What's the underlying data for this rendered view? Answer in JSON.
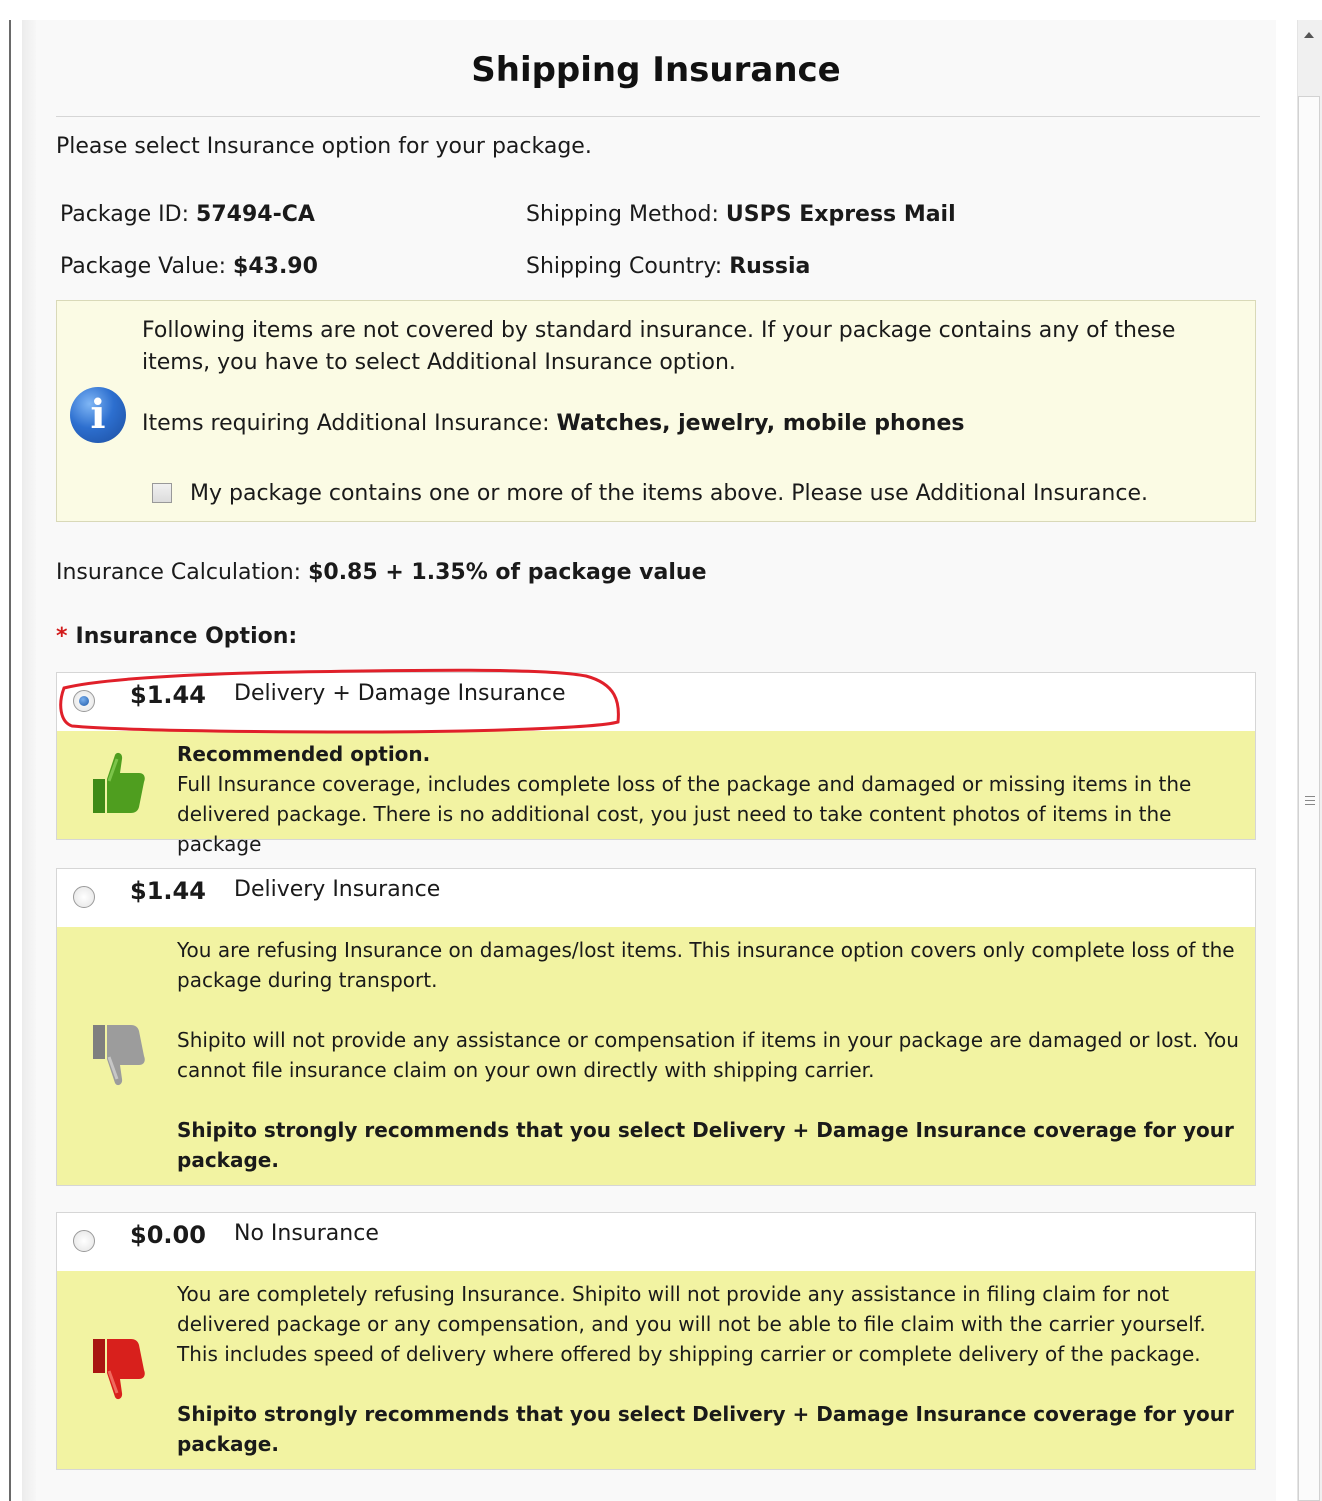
{
  "dialog": {
    "title": "Shipping Insurance",
    "intro": "Please select Insurance option for your package."
  },
  "package": {
    "id_label": "Package ID:",
    "id_value": "57494-CA",
    "value_label": "Package Value:",
    "value_value": "$43.90",
    "method_label": "Shipping Method:",
    "method_value": "USPS Express Mail",
    "country_label": "Shipping Country:",
    "country_value": "Russia"
  },
  "notice": {
    "text": "Following items are not covered by standard insurance. If your package contains any of these items, you have to select Additional Insurance option.",
    "items_label": "Items requiring Additional Insurance:",
    "items_value": "Watches, jewelry, mobile phones",
    "checkbox_label": "My package contains one or more of the items above. Please use Additional Insurance.",
    "checkbox_checked": false
  },
  "calculation": {
    "label": "Insurance Calculation:",
    "value": "$0.85 + 1.35% of package value"
  },
  "options_heading": "Insurance Option:",
  "options": [
    {
      "price": "$1.44",
      "name": "Delivery + Damage Insurance",
      "selected": true,
      "thumb": "thumbs-up",
      "desc_bold": "Recommended option.",
      "desc": "Full Insurance coverage, includes complete loss of the package and damaged or missing items in the delivered package. There is no additional cost, you just need to take content photos of items in the package"
    },
    {
      "price": "$1.44",
      "name": "Delivery Insurance",
      "selected": false,
      "thumb": "thumbs-down-gray",
      "desc1": "You are refusing Insurance on damages/lost items. This insurance option covers only complete loss of the package during transport.",
      "desc2": "Shipito will not provide any assistance or compensation if items in your package are damaged or lost. You cannot file insurance claim on your own directly with shipping carrier.",
      "desc_bold": "Shipito strongly recommends that you select Delivery + Damage Insurance coverage for your package."
    },
    {
      "price": "$0.00",
      "name": "No Insurance",
      "selected": false,
      "thumb": "thumbs-down-red",
      "desc1": "You are completely refusing Insurance. Shipito will not provide any assistance in filing claim for not delivered package or any compensation, and you will not be able to file claim with the carrier yourself. This includes speed of delivery where offered by shipping carrier or complete delivery of the package.",
      "desc_bold": "Shipito strongly recommends that you select Delivery + Damage Insurance coverage for your package."
    }
  ],
  "colors": {
    "notice_bg": "#fbfbe4",
    "option_desc_bg": "#f2f3a2",
    "required_star": "#d21b1b",
    "annotation_ring": "#e0202a",
    "thumb_up": "#4f9e1f",
    "thumb_down_gray": "#9c9c9c",
    "thumb_down_red": "#d8201c"
  }
}
